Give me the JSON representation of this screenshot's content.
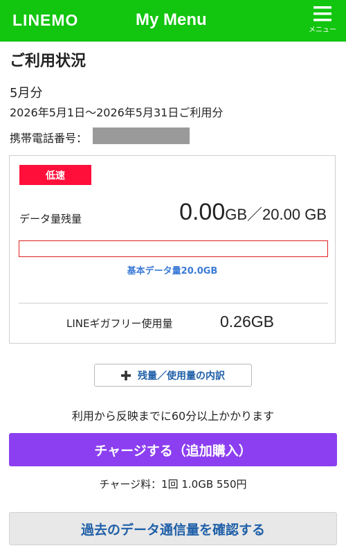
{
  "header": {
    "logo": "LINEMO",
    "title": "My Menu",
    "menu_icon": "hamburger-icon",
    "menu_label": "メニュー",
    "bg_color": "#12c50f"
  },
  "usage": {
    "section_title": "ご利用状況",
    "month": "5月分",
    "period": "2026年5月1日〜2026年5月31日ご利用分",
    "phone_label": "携帯電話番号："
  },
  "card": {
    "speed_badge": "低速",
    "remaining_label": "データ量残量",
    "remaining_value": "0.00",
    "remaining_unit": "GB",
    "remaining_total": "／20.00 GB",
    "remaining_fraction": 0.0,
    "basic_data": "基本データ量20.0GB",
    "free_label": "LINEギガフリー使用量",
    "free_value": "0.26GB"
  },
  "breakdown_button": {
    "icon": "plus-icon",
    "label": "残量／使用量の内訳"
  },
  "notice": "利用から反映までに60分以上かかります",
  "charge_button": {
    "label": "チャージする（追加購入）",
    "color": "#8b3ff0"
  },
  "charge_fee": "チャージ料：1回 1.0GB 550円",
  "history_button": {
    "label": "過去のデータ通信量を確認する"
  }
}
